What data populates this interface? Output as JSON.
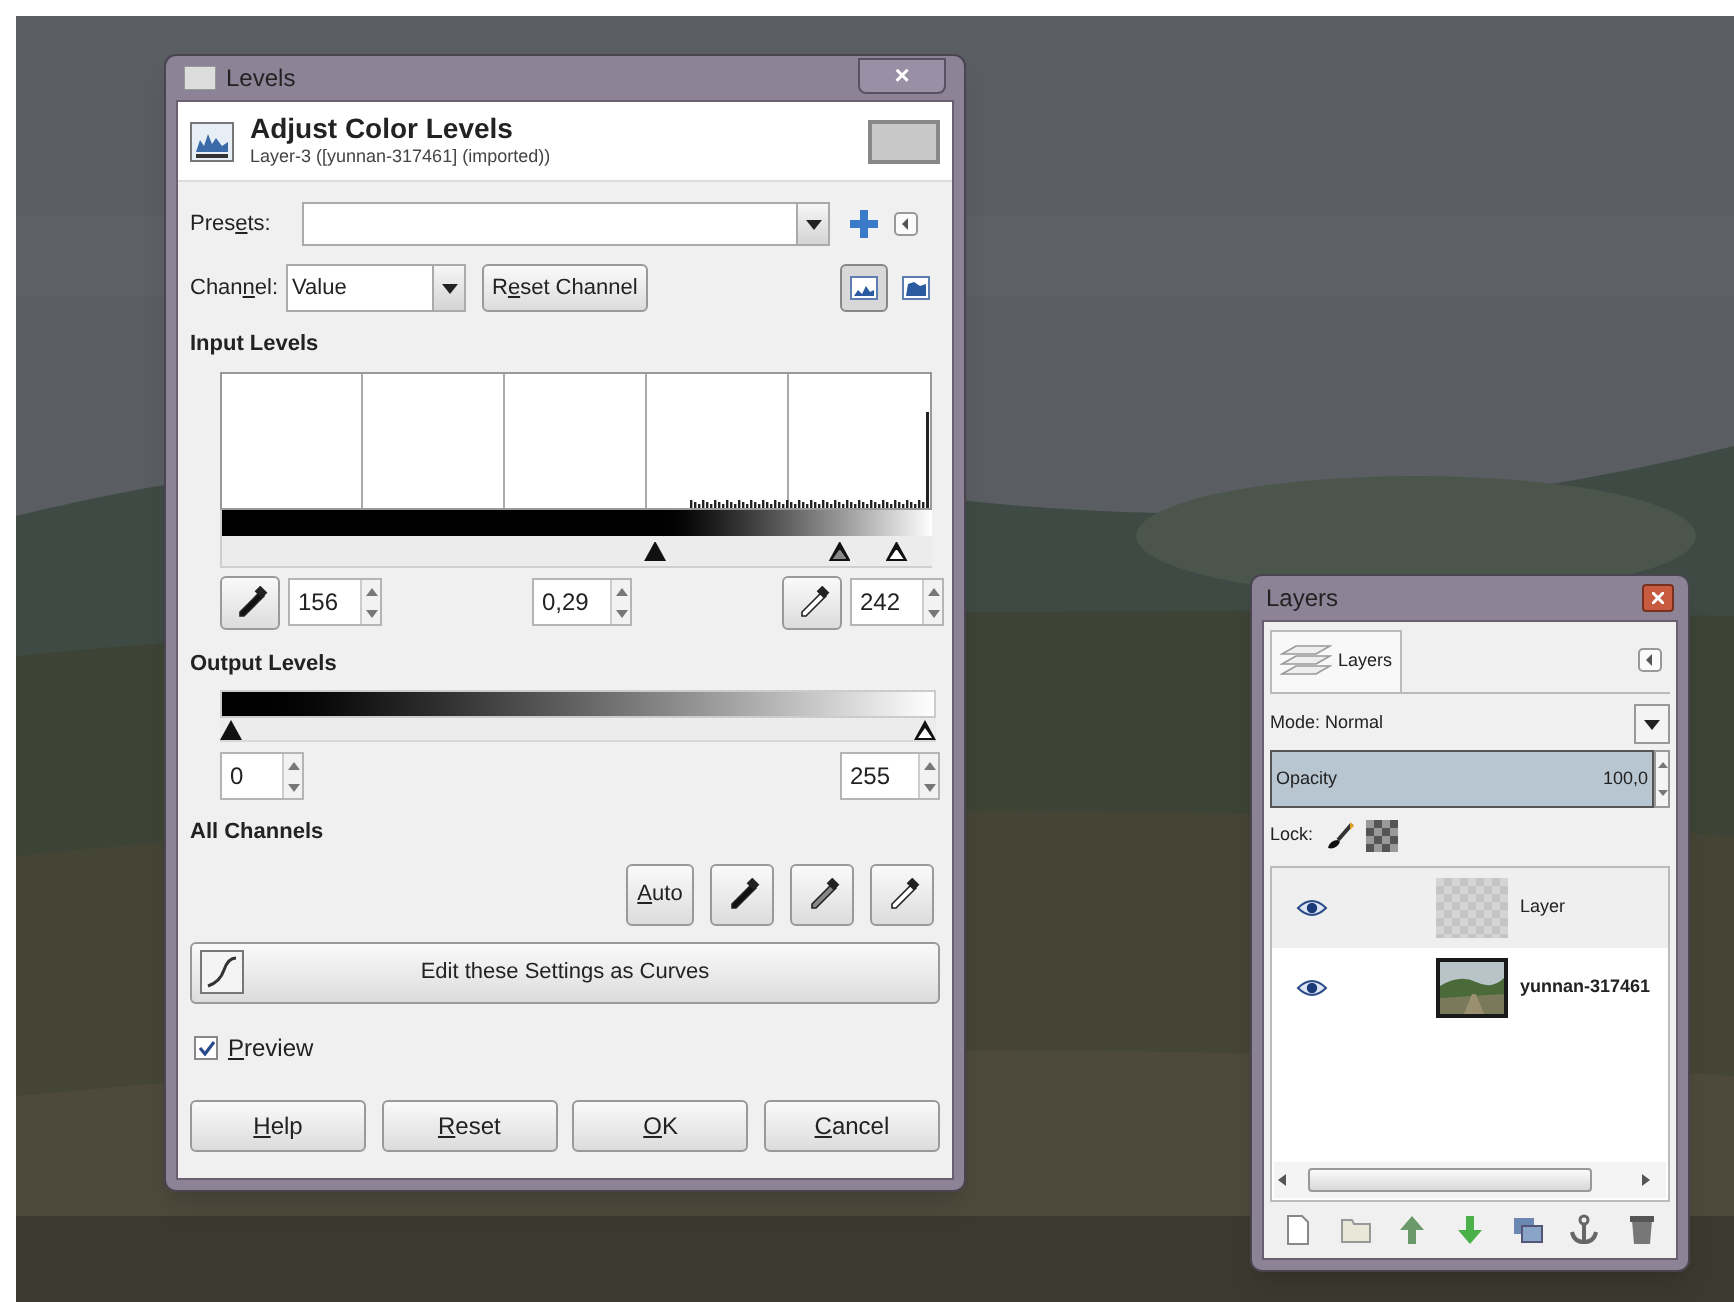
{
  "levels_dialog": {
    "title": "Levels",
    "close": "×",
    "header": {
      "title": "Adjust Color Levels",
      "subtitle": "Layer-3 ([yunnan-317461] (imported))"
    },
    "presets": {
      "label": "Presets:"
    },
    "channel": {
      "label": "Channel:",
      "value": "Value",
      "reset_button": "Reset Channel"
    },
    "view_toggles": [
      {
        "kind": "linear",
        "selected": true
      },
      {
        "kind": "log",
        "selected": false
      }
    ],
    "input_levels": {
      "heading": "Input Levels",
      "black_value": "156",
      "gamma_value": "0,29",
      "white_value": "242",
      "handles": [
        {
          "kind": "black",
          "level": 0.61
        },
        {
          "kind": "gray",
          "level": 0.87
        },
        {
          "kind": "white",
          "level": 0.95
        }
      ]
    },
    "output_levels": {
      "heading": "Output Levels",
      "low_value": "0",
      "high_value": "255",
      "handles": [
        {
          "kind": "black",
          "level": 0
        },
        {
          "kind": "white",
          "level": 1
        }
      ]
    },
    "all_channels": {
      "heading": "All Channels",
      "auto_button": "Auto"
    },
    "curves_button": "Edit these Settings as Curves",
    "preview": {
      "label": "Preview",
      "checked": true
    },
    "buttons": [
      "Help",
      "Reset",
      "OK",
      "Cancel"
    ]
  },
  "layers_panel": {
    "title": "Layers",
    "tab": "Layers",
    "mode": "Mode: Normal",
    "opacity": {
      "label": "Opacity",
      "value": "100,0",
      "level": 1
    },
    "lock_label": "Lock:",
    "layers": [
      {
        "name": "Layer",
        "visible": true,
        "selected": true,
        "bold": false,
        "kind": "transparent"
      },
      {
        "name": "yunnan-317461",
        "visible": true,
        "selected": false,
        "bold": true
      }
    ]
  }
}
